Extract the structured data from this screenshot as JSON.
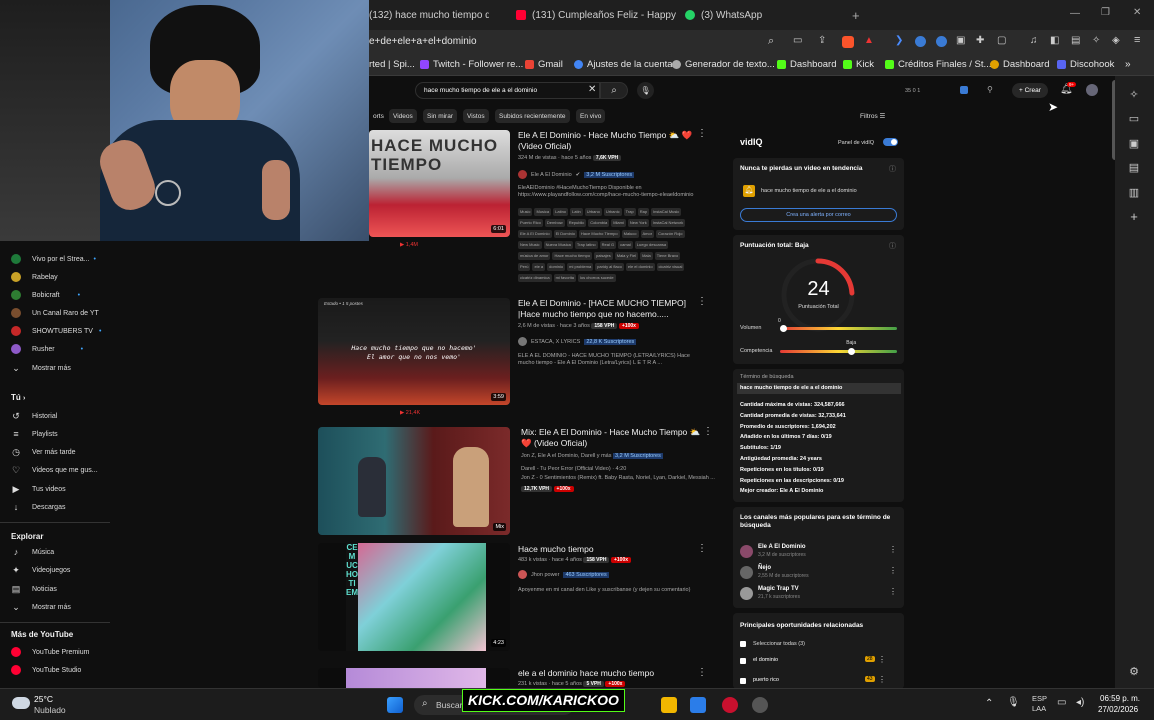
{
  "browser": {
    "tabs": [
      {
        "label": "(132) hace mucho tiempo de ele",
        "color": "#ff0033"
      },
      {
        "label": "(131) Cumpleaños Feliz - Happy Birt",
        "color": "#ff0033"
      },
      {
        "label": "(3) WhatsApp",
        "color": "#25d366"
      }
    ],
    "new_tab": "+",
    "url": "e+de+ele+a+el+dominio",
    "bookmarks": [
      {
        "label": "rted | Spi...",
        "color": "#888"
      },
      {
        "label": "Twitch - Follower re...",
        "color": "#9146ff"
      },
      {
        "label": "Gmail",
        "color": "#ea4335"
      },
      {
        "label": "Ajustes de la cuenta",
        "color": "#4285f4"
      },
      {
        "label": "Generador de texto...",
        "color": "#aaa"
      },
      {
        "label": "Dashboard",
        "color": "#53fc18"
      },
      {
        "label": "Kick",
        "color": "#53fc18"
      },
      {
        "label": "Créditos Finales / St...",
        "color": "#53fc18"
      },
      {
        "label": "Dashboard",
        "color": "#e0a000"
      },
      {
        "label": "Discohook",
        "color": "#5865f2"
      }
    ]
  },
  "youtube": {
    "search_value": "hace mucho tiempo de ele a el dominio",
    "create_label": "Crear",
    "notif_count": "9+",
    "filters_label": "Filtros",
    "vidiq_stats_top": "35 0 1",
    "chips": [
      "orts",
      "Videos",
      "Sin mirar",
      "Vistos",
      "Subidos recientemente",
      "En vivo"
    ],
    "sidebar_subs": [
      {
        "label": "Vivo por el Strea...",
        "color": "#1e7a3a",
        "dot": true
      },
      {
        "label": "Rabelay",
        "color": "#c9a227",
        "dot": false
      },
      {
        "label": "Bobicraft",
        "color": "#2e7d32",
        "dot": true
      },
      {
        "label": "Un Canal Raro de YT",
        "color": "#7a4e2e",
        "dot": false
      },
      {
        "label": "SHOWTUBERS TV",
        "color": "#c62828",
        "dot": true
      },
      {
        "label": "Rusher",
        "color": "#8e5ac8",
        "dot": true
      }
    ],
    "show_more": "Mostrar más",
    "you_header": "Tú",
    "you_items": [
      {
        "icon": "↺",
        "label": "Historial",
        "name": "history-icon"
      },
      {
        "icon": "≡",
        "label": "Playlists",
        "name": "playlists-icon"
      },
      {
        "icon": "◷",
        "label": "Ver más tarde",
        "name": "clock-icon"
      },
      {
        "icon": "♡",
        "label": "Videos que me gus...",
        "name": "like-icon"
      },
      {
        "icon": "▶",
        "label": "Tus videos",
        "name": "your-videos-icon"
      },
      {
        "icon": "↓",
        "label": "Descargas",
        "name": "download-icon"
      }
    ],
    "explore_header": "Explorar",
    "explore_items": [
      {
        "icon": "♪",
        "label": "Música",
        "name": "music-icon"
      },
      {
        "icon": "✦",
        "label": "Videojuegos",
        "name": "gaming-icon"
      },
      {
        "icon": "▤",
        "label": "Noticias",
        "name": "news-icon"
      }
    ],
    "more_header": "Más de YouTube",
    "more_items": [
      {
        "label": "YouTube Premium",
        "color": "#ff0033"
      },
      {
        "label": "YouTube Studio",
        "color": "#ff0033"
      }
    ],
    "videos": [
      {
        "title": "Ele A El Dominio - Hace Mucho Tiempo ⛅ ❤️ (Video Oficial)",
        "meta": "324 M de vistas · hace 5 años",
        "vph": "7,6K VPH",
        "channel": "Ele A El Dominio",
        "subs": "3,2 M Suscriptores",
        "desc": "EleAElDominio #HaceMuchoTiempo Disponible en https://www.playandfollow.com/comp/hace-mucho-tiempo-eleaeldominio",
        "tags": [
          "Music",
          "Musica",
          "Latino",
          "Latin",
          "Urbano",
          "Urbanic",
          "Trap",
          "Rap",
          "InstaCal Music",
          "Puerto Rico",
          "Dembow",
          "Republic",
          "Colombia",
          "Miami",
          "New York",
          "InstaCal Network",
          "Ele A El Dominio",
          "El Dominio",
          "Hace Mucho Tiempo",
          "Maluco",
          "Amor",
          "Corazón Rojo",
          "New Music",
          "Nueva Musica",
          "Trap latino",
          "Real G",
          "camal",
          "Luego descansa",
          "música de amor",
          "Hace mucho tiempo",
          "paisajes",
          "Mala y Fiel",
          "Mala",
          "Tiene Bravo",
          "Perú",
          "ele a",
          "dominio",
          "mi problema",
          "paridy al flaco",
          "ele el dominio",
          "cicatriz visual",
          "cicatriz dinamica",
          "mi favorita",
          "los chorros sucede"
        ],
        "thumb_text": "HACE MUCHO TIEMPO",
        "duration": "6:01",
        "likes": "1,4M"
      },
      {
        "title": "Ele A El Dominio - [HACE MUCHO TIEMPO] |Hace mucho tiempo que no hacemo.....",
        "meta": "2,6 M de vistas · hace 3 años",
        "vph": "158 VPH",
        "boost": "+100x",
        "channel": "ESTACA, X LYRICS",
        "subs": "22,8 K Suscriptores",
        "desc": "ELE A EL DOMINIO - HACE MUCHO TIEMPO (LETRA/LYRICS) Hace mucho tiempo - Ele A El Dominio (Letra/Lyrics) L E T R A ...",
        "thumb_line1": "Hace mucho tiempo que no hacemo'",
        "thumb_line2": "El amor que no nos vemo'",
        "thumb_top": "Estado • 1 5 postes",
        "duration": "3:59",
        "likes": "21,4K"
      },
      {
        "title": "Mix: Ele A El Dominio - Hace Mucho Tiempo ⛅ ❤️ (Video Oficial)",
        "meta": "Jon Z, Ele A el Dominio, Darell y más",
        "subs": "3,2 M Suscriptores",
        "line1": "Darell - Tu Peor Error (Official Video) · 4:20",
        "line2": "Jon Z - 0 Sentimientos (Remix) ft. Baby Rasta, Noriel, Lyan, Darkiel, Messiah ...",
        "vph": "12,7K VPH",
        "boost": "+100x",
        "duration": "Mix"
      },
      {
        "title": "Hace mucho tiempo",
        "meta": "483 k vistas · hace 4 años",
        "vph": "158 VPH",
        "boost": "+100x",
        "channel": "Jhon power",
        "subs": "463 Suscriptores",
        "desc": "Apoyenme en mi canal den Like y suscribanse (y dejen su comentario)",
        "duration": "4:23",
        "thumb_side": "CE MUCHO TIEM"
      },
      {
        "title": "ele a el dominio hace mucho tiempo",
        "meta": "231 k vistas · hace 5 años",
        "vph": "5 VPH",
        "boost": "+100x"
      }
    ]
  },
  "vidiq": {
    "logo": "vidIQ",
    "panel_label": "Panel de vidIQ",
    "trend_title": "Nunca te pierdas un video en tendencia",
    "trend_query": "hace mucho tiempo de ele a el dominio",
    "trend_button": "Crea una alerta por correo",
    "score_title": "Puntuación total: Baja",
    "score": "24",
    "score_label": "Puntuación Total",
    "volume_label": "Volumen",
    "volume_value": "0",
    "volume_level": 0,
    "competition_label": "Competencia",
    "competition_value": "Baja",
    "competition_level": 0.62,
    "term_header": "Término de búsqueda",
    "term": "hace mucho tiempo de ele a el dominio",
    "stats": [
      "Cantidad máxima de vistas: 324,587,666",
      "Cantidad promedia de vistas: 32,733,641",
      "Promedio de suscriptores: 1,694,202",
      "Añadido en los últimos 7 días: 0/19",
      "Subtitulos: 1/19",
      "Antigüedad promedia: 24 years",
      "Repeticiones en los títulos: 0/19",
      "Repeticiones en las descripciones: 0/19",
      "Mejor creador: Ele A El Dominio"
    ],
    "channels_title": "Los canales más populares para este término de búsqueda",
    "channels": [
      {
        "name": "Ele A El Dominio",
        "subs": "3,2 M de suscriptores"
      },
      {
        "name": "Ñejo",
        "subs": "2,55 M de suscriptores"
      },
      {
        "name": "Magic Trap TV",
        "subs": "21,7 k suscriptores"
      }
    ],
    "opps_title": "Principales oportunidades relacionadas",
    "select_all": "Seleccionar todas (3)",
    "opps": [
      {
        "label": "el dominio",
        "score": "28"
      },
      {
        "label": "puerto rico",
        "score": "43"
      }
    ]
  },
  "taskbar": {
    "weather_temp": "25°C",
    "weather_text": "Nublado",
    "search_text": "Buscar",
    "overlay_text": "KICK.COM/KARICKOO",
    "lang1": "ESP",
    "lang2": "LAA",
    "time": "06:59 p. m.",
    "date": "27/02/2026"
  }
}
